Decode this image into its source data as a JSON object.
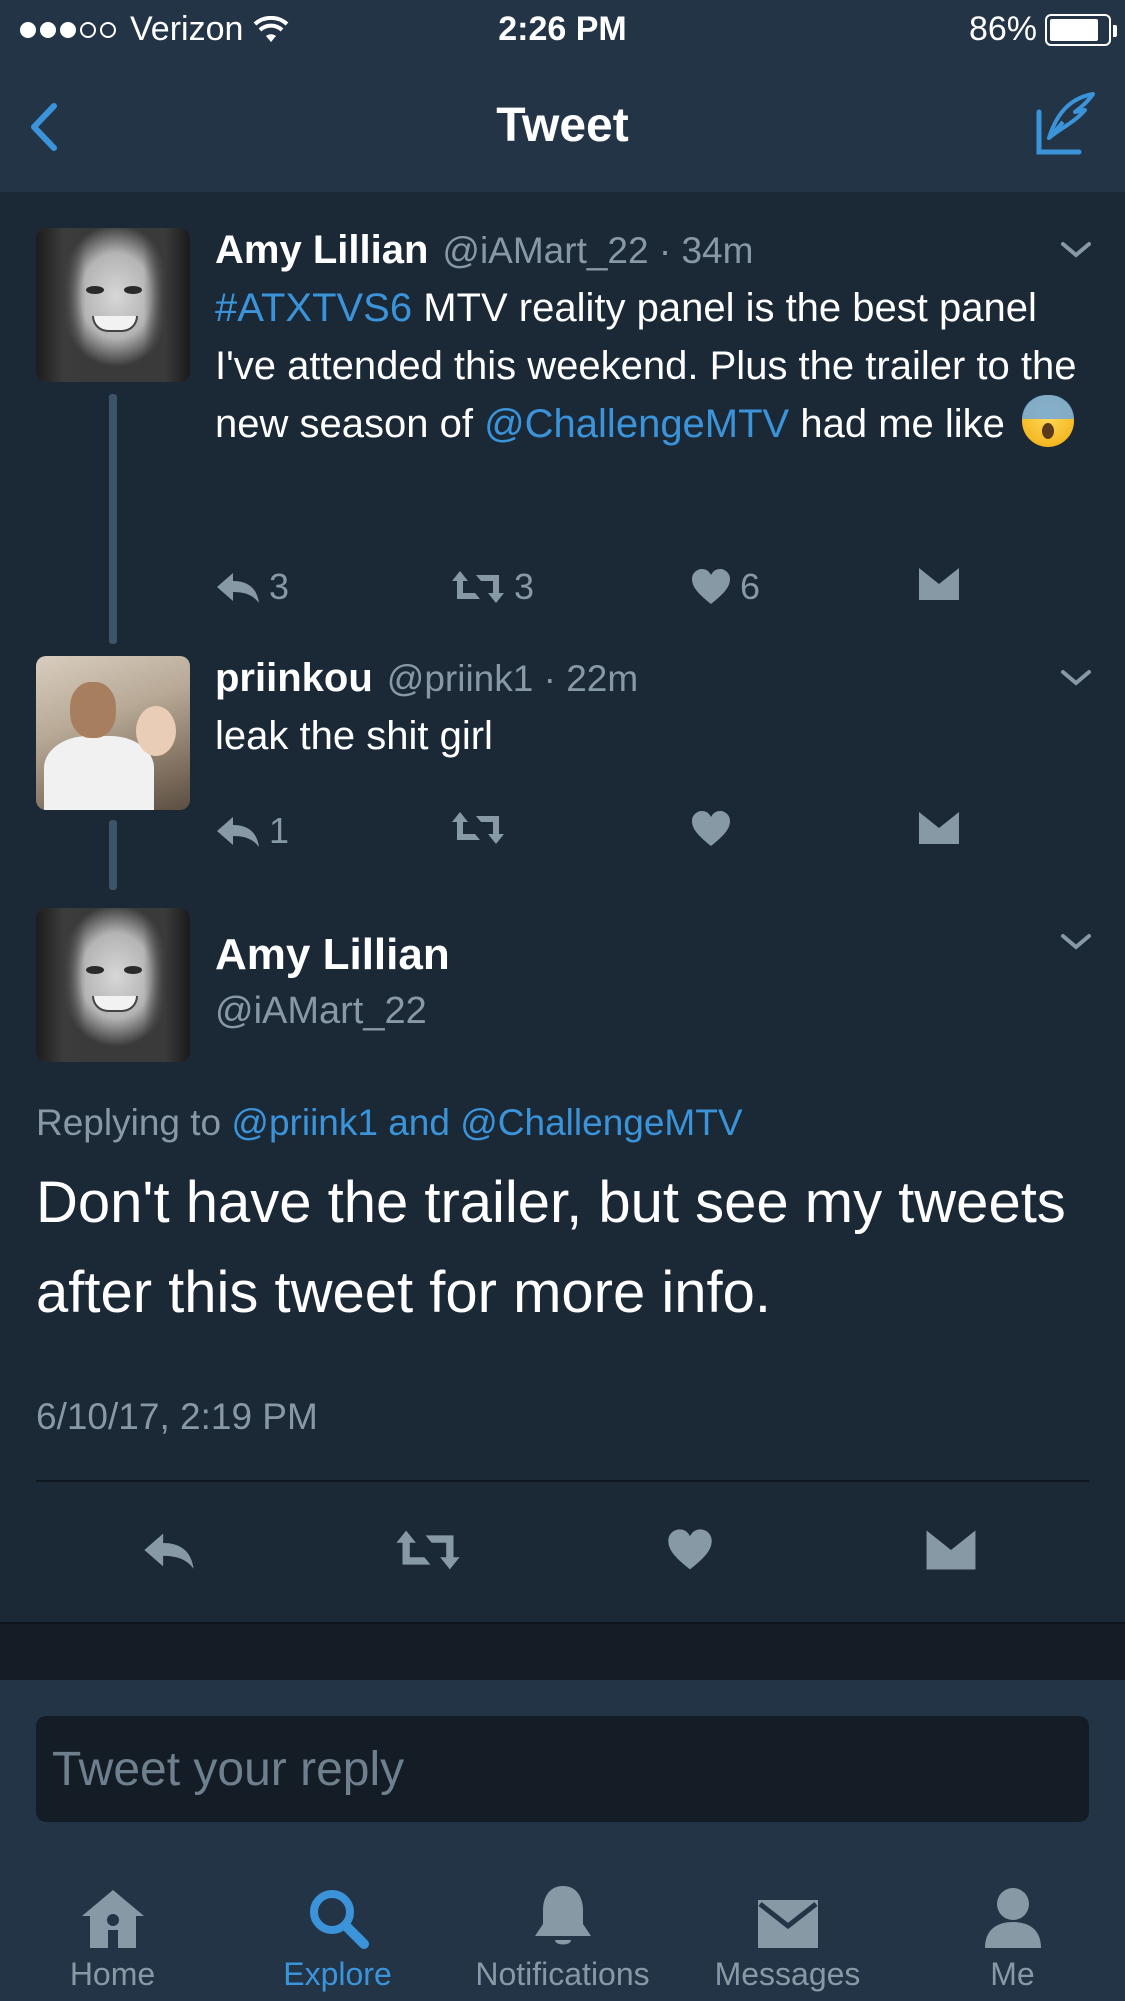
{
  "status_bar": {
    "carrier": "Verizon",
    "time": "2:26 PM",
    "battery": "86%",
    "battery_level": 0.86
  },
  "nav": {
    "title": "Tweet",
    "back_icon": "chevron-left-icon",
    "compose_icon": "compose-tweet-icon"
  },
  "tweets": [
    {
      "name": "Amy Lillian",
      "handle_time": "@iAMart_22 · 34m",
      "hashtag": "#ATXTVS6",
      "text_a": " MTV reality panel is the best panel I've attended this weekend. Plus the trailer to the new season of ",
      "mention": "@ChallengeMTV",
      "text_b": " had me like ",
      "emoji": "screaming-face-emoji",
      "reply_count": "3",
      "retweet_count": "3",
      "like_count": "6"
    },
    {
      "name": "priinkou",
      "handle_time": "@priink1 · 22m",
      "text": "leak the shit girl",
      "reply_count": "1",
      "retweet_count": "",
      "like_count": ""
    }
  ],
  "detail": {
    "name": "Amy Lillian",
    "handle": "@iAMart_22",
    "replying_prefix": "Replying to ",
    "replying_targets": "@priink1 and @ChallengeMTV",
    "text": "Don't have the trailer, but see my tweets after this tweet for more info.",
    "timestamp": "6/10/17, 2:19 PM"
  },
  "reply_box": {
    "placeholder": "Tweet your reply"
  },
  "tabs": [
    {
      "label": "Home",
      "icon": "home-icon",
      "active": false
    },
    {
      "label": "Explore",
      "icon": "search-icon",
      "active": true
    },
    {
      "label": "Notifications",
      "icon": "bell-icon",
      "active": false
    },
    {
      "label": "Messages",
      "icon": "envelope-icon",
      "active": false
    },
    {
      "label": "Me",
      "icon": "person-icon",
      "active": false
    }
  ],
  "colors": {
    "background": "#1b2836",
    "bar": "#243447",
    "accent": "#3b94d9",
    "muted": "#8899a6"
  }
}
